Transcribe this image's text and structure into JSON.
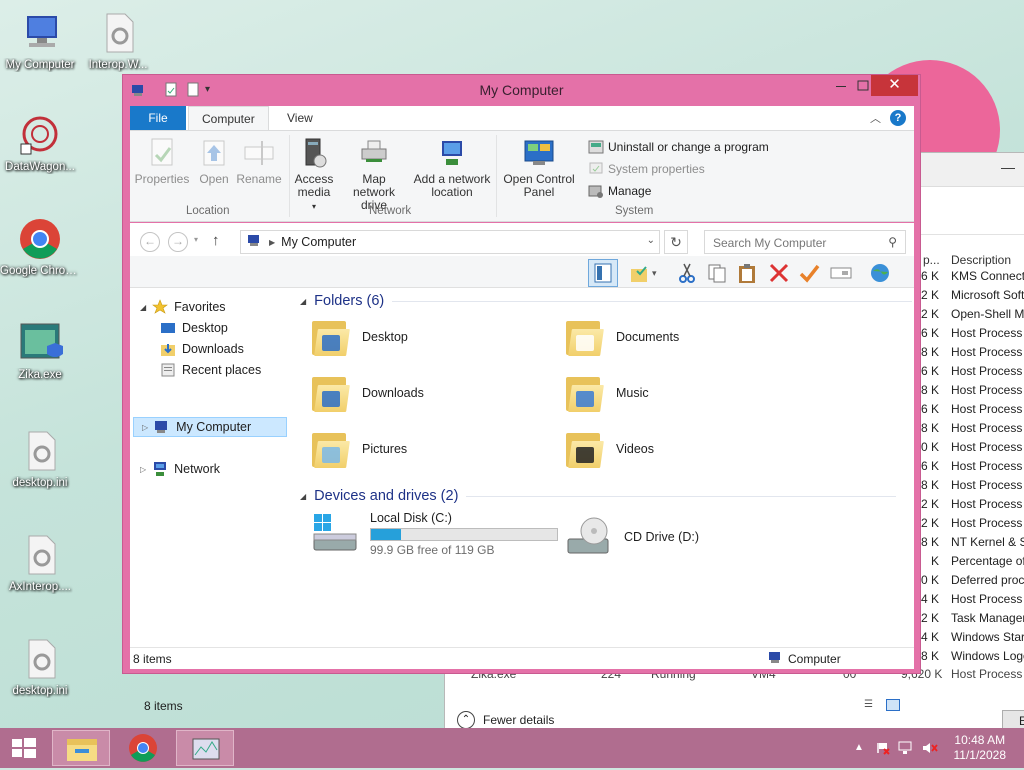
{
  "desktop": {
    "icons": [
      {
        "label": "My Computer",
        "icon": "computer-icon"
      },
      {
        "label": "Interop.W...",
        "icon": "settings-file-icon"
      },
      {
        "label": "DataWagon...",
        "icon": "app-shortcut-icon"
      },
      {
        "label": "Google Chrome",
        "icon": "chrome-icon"
      },
      {
        "label": "Zika.exe",
        "icon": "exe-shield-icon"
      },
      {
        "label": "desktop.ini",
        "icon": "settings-file-icon"
      },
      {
        "label": "AxInterop....",
        "icon": "settings-file-icon"
      },
      {
        "label": "desktop.ini",
        "icon": "settings-file-icon"
      }
    ]
  },
  "taskmanager": {
    "col_header_partial": "p...",
    "col_header_desc": "Description",
    "rows": [
      {
        "k": "6 K",
        "desc": "KMS Connecti"
      },
      {
        "k": "2 K",
        "desc": "Microsoft Soft"
      },
      {
        "k": "2 K",
        "desc": "Open-Shell M"
      },
      {
        "k": "6 K",
        "desc": "Host Process f"
      },
      {
        "k": "8 K",
        "desc": "Host Process f"
      },
      {
        "k": "6 K",
        "desc": "Host Process f"
      },
      {
        "k": "8 K",
        "desc": "Host Process f"
      },
      {
        "k": "6 K",
        "desc": "Host Process f"
      },
      {
        "k": "8 K",
        "desc": "Host Process f"
      },
      {
        "k": "0 K",
        "desc": "Host Process f"
      },
      {
        "k": "6 K",
        "desc": "Host Process f"
      },
      {
        "k": "8 K",
        "desc": "Host Process f"
      },
      {
        "k": "2 K",
        "desc": "Host Process f"
      },
      {
        "k": "2 K",
        "desc": "Host Process f"
      },
      {
        "k": "8 K",
        "desc": "NT Kernel & S"
      },
      {
        "k": "K",
        "desc": "Percentage of"
      },
      {
        "k": "0 K",
        "desc": "Deferred proce"
      },
      {
        "k": "4 K",
        "desc": "Host Process f"
      },
      {
        "k": "2 K",
        "desc": "Task Manager"
      },
      {
        "k": "4 K",
        "desc": "Windows Start"
      },
      {
        "k": "8 K",
        "desc": "Windows Logo"
      }
    ],
    "last_row": {
      "name": "Zika.exe",
      "pid": "224",
      "status": "Running",
      "user": "VM4",
      "cpu": "00",
      "mem": "9,620 K",
      "desc": "Host Process f"
    },
    "fewer_details": "Fewer details",
    "end_button": "E"
  },
  "explorer": {
    "title": "My Computer",
    "tabs": {
      "file": "File",
      "computer": "Computer",
      "view": "View"
    },
    "ribbon": {
      "location": {
        "label": "Location",
        "properties": "Properties",
        "open": "Open",
        "rename": "Rename"
      },
      "network": {
        "label": "Network",
        "access_media": "Access media",
        "map_drive": "Map network drive",
        "add_location": "Add a network location"
      },
      "system": {
        "label": "System",
        "open_control_panel": "Open Control Panel",
        "uninstall": "Uninstall or change a program",
        "system_properties": "System properties",
        "manage": "Manage"
      }
    },
    "address": {
      "path": "My Computer",
      "search_placeholder": "Search My Computer"
    },
    "nav": {
      "favorites": "Favorites",
      "desktop": "Desktop",
      "downloads": "Downloads",
      "recent": "Recent places",
      "my_computer": "My Computer",
      "network": "Network"
    },
    "folders_header": "Folders (6)",
    "folders": [
      {
        "name": "Desktop",
        "icon": "desktop-folder-icon"
      },
      {
        "name": "Documents",
        "icon": "documents-folder-icon"
      },
      {
        "name": "Downloads",
        "icon": "downloads-folder-icon"
      },
      {
        "name": "Music",
        "icon": "music-folder-icon"
      },
      {
        "name": "Pictures",
        "icon": "pictures-folder-icon"
      },
      {
        "name": "Videos",
        "icon": "videos-folder-icon"
      }
    ],
    "drives_header": "Devices and drives (2)",
    "drives": {
      "c": {
        "name": "Local Disk (C:)",
        "free": "99.9 GB free of 119 GB",
        "used_fraction": 0.16
      },
      "d": {
        "name": "CD Drive (D:)"
      }
    },
    "item_count": "8 items",
    "status_items": "8 items",
    "status_location": "Computer"
  },
  "taskbar": {
    "time": "10:48 AM",
    "date": "11/1/2028"
  },
  "colors": {
    "accent": "#1979ca",
    "titlebar": "#e471a8",
    "taskbar": "#b06d8f",
    "close": "#c7343a",
    "drive_bar": "#26a0da"
  }
}
